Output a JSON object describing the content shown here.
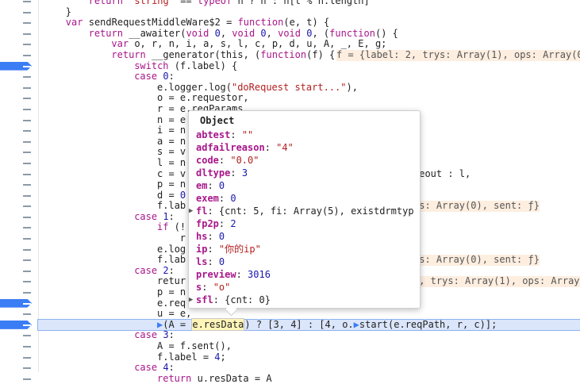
{
  "code_lines": [
    {
      "indent": 8,
      "text": "return \"string\" == typeof n ? n : n[t % n.length]",
      "dash": true
    },
    {
      "indent": 4,
      "text": "}",
      "dash": true
    },
    {
      "indent": 4,
      "text": "var sendRequestMiddleWare$2 = function(e, t) {",
      "dash": true
    },
    {
      "indent": 8,
      "text": "return __awaiter(void 0, void 0, void 0, (function() {",
      "dash": true
    },
    {
      "indent": 12,
      "text": "var o, r, n, i, a, s, l, c, p, d, u, A, _, E, g;",
      "dash": true
    },
    {
      "indent": 12,
      "text": "return __generator(this, (function(f) {",
      "dash": true,
      "inline": "f = {label: 2, trys: Array(1), ops: Array(0)"
    },
    {
      "indent": 16,
      "text": "switch (f.label) {",
      "dash": true,
      "breakpoint": true
    },
    {
      "indent": 16,
      "text": "case 0:",
      "dash": true
    },
    {
      "indent": 20,
      "text": "e.logger.log(\"doRequest start...\"),",
      "dash": true
    },
    {
      "indent": 20,
      "text": "o = e.requestor,",
      "dash": true
    },
    {
      "indent": 20,
      "text": "r = e.reqParams,",
      "dash": true
    },
    {
      "indent": 20,
      "text": "n = e",
      "dash": true
    },
    {
      "indent": 20,
      "text": "i = n",
      "dash": true
    },
    {
      "indent": 20,
      "text": "a = n",
      "dash": true
    },
    {
      "indent": 20,
      "text": "s = v",
      "dash": true
    },
    {
      "indent": 20,
      "text": "l = n",
      "dash": true
    },
    {
      "indent": 20,
      "text": "c = v",
      "dash": true,
      "tail": "meout : l,"
    },
    {
      "indent": 20,
      "text": "p = n",
      "dash": true
    },
    {
      "indent": 20,
      "text": "d = 0",
      "dash": true
    },
    {
      "indent": 20,
      "text": "f.lab",
      "dash": true,
      "inline": "ps: Array(0), sent: ƒ}"
    },
    {
      "indent": 16,
      "text": "case 1:",
      "dash": true
    },
    {
      "indent": 20,
      "text": "if (!",
      "dash": true
    },
    {
      "indent": 24,
      "text": "r",
      "dash": true
    },
    {
      "indent": 20,
      "text": "e.log",
      "dash": true
    },
    {
      "indent": 20,
      "text": "f.lab",
      "dash": true,
      "inline": "ps: Array(0), sent: ƒ}"
    },
    {
      "indent": 16,
      "text": "case 2:",
      "dash": true
    },
    {
      "indent": 20,
      "text": "retur",
      "dash": true,
      "inline": "2, trys: Array(1), ops: Array"
    },
    {
      "indent": 20,
      "text": "p = n",
      "dash": true
    },
    {
      "indent": 20,
      "text": "e.req",
      "dash": true,
      "breakpoint": true
    },
    {
      "indent": 20,
      "text": "u = e,",
      "dash": true
    },
    {
      "indent": 20,
      "text": "",
      "dash": true,
      "breakpoint": true,
      "exec": true
    },
    {
      "indent": 16,
      "text": "case 3:",
      "dash": true
    },
    {
      "indent": 20,
      "text": "A = f.sent(),",
      "dash": true
    },
    {
      "indent": 20,
      "text": "f.label = 4;",
      "dash": true
    },
    {
      "indent": 16,
      "text": "case 4:",
      "dash": true
    },
    {
      "indent": 20,
      "text": "return u.resData = A",
      "dash": true
    }
  ],
  "exec_line": {
    "prefix": "(A = ",
    "highlight": "e.resData",
    "suffix": ") ? [3, 4] : [4, o.",
    "suffix2": "start(e.reqPath, r, c)];"
  },
  "popover": {
    "title": "Object",
    "props": [
      {
        "key": "abtest",
        "value": "\"\"",
        "kind": "str",
        "expandable": false
      },
      {
        "key": "adfailreason",
        "value": "\"4\"",
        "kind": "str",
        "expandable": false
      },
      {
        "key": "code",
        "value": "\"0.0\"",
        "kind": "str",
        "expandable": false
      },
      {
        "key": "dltype",
        "value": "3",
        "kind": "num",
        "expandable": false
      },
      {
        "key": "em",
        "value": "0",
        "kind": "num",
        "expandable": false
      },
      {
        "key": "exem",
        "value": "0",
        "kind": "num",
        "expandable": false
      },
      {
        "key": "fl",
        "value": "{cnt: 5, fi: Array(5), existdrmtyp",
        "kind": "obj",
        "expandable": true
      },
      {
        "key": "fp2p",
        "value": "2",
        "kind": "num",
        "expandable": false
      },
      {
        "key": "hs",
        "value": "0",
        "kind": "num",
        "expandable": false
      },
      {
        "key": "ip",
        "value": "\"你的ip\"",
        "kind": "str",
        "expandable": false
      },
      {
        "key": "ls",
        "value": "0",
        "kind": "num",
        "expandable": false
      },
      {
        "key": "preview",
        "value": "3016",
        "kind": "num",
        "expandable": false
      },
      {
        "key": "s",
        "value": "\"o\"",
        "kind": "str",
        "expandable": false
      },
      {
        "key": "sfl",
        "value": "{cnt: 0}",
        "kind": "obj",
        "expandable": true
      }
    ]
  }
}
